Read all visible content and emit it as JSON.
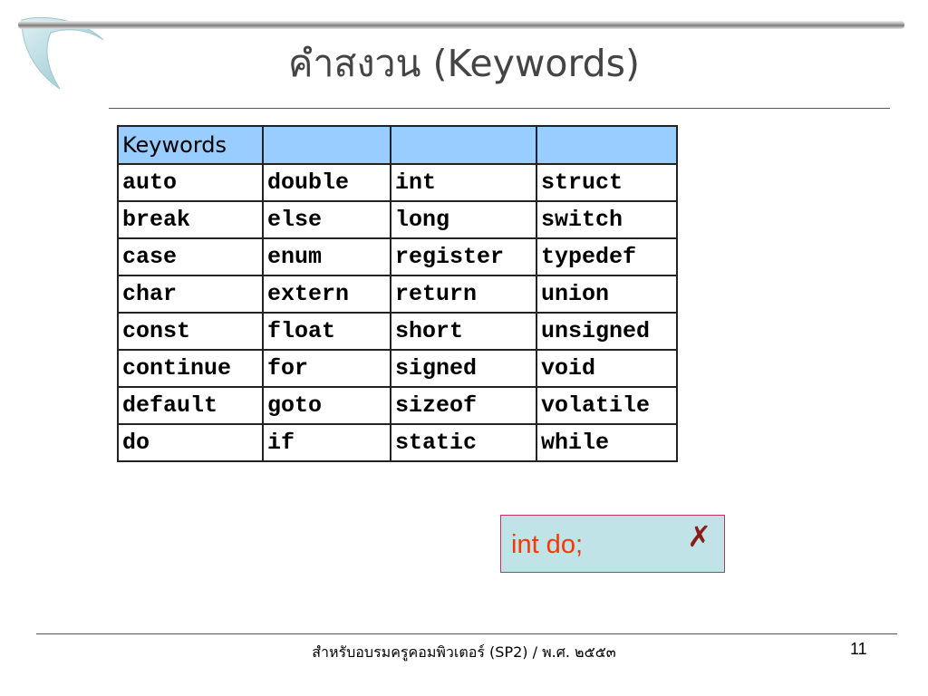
{
  "slide": {
    "title": "คำสงวน (Keywords)",
    "table": {
      "header": [
        "Keywords",
        "",
        "",
        ""
      ],
      "rows": [
        [
          "auto",
          "double",
          "int",
          "struct"
        ],
        [
          "break",
          "else",
          "long",
          "switch"
        ],
        [
          "case",
          "enum",
          "register",
          "typedef"
        ],
        [
          "char",
          "extern",
          "return",
          "union"
        ],
        [
          "const",
          "float",
          "short",
          "unsigned"
        ],
        [
          "continue",
          "for",
          "signed",
          "void"
        ],
        [
          "default",
          "goto",
          "sizeof",
          "volatile"
        ],
        [
          "do",
          "if",
          "static",
          "while"
        ]
      ]
    },
    "example": {
      "code": "int do;",
      "mark": "✗",
      "mark_icon": "cross-icon"
    },
    "footer": {
      "text": "สำหรับอบรมครูคอมพิวเตอร์ (SP2) / พ.ศ. ๒๕๕๓",
      "page_number": "11"
    },
    "colors": {
      "header_fill": "#99ccff",
      "example_fill": "#bfe3e6",
      "example_text": "#ff3300",
      "cross": "#8b1a1a"
    }
  }
}
